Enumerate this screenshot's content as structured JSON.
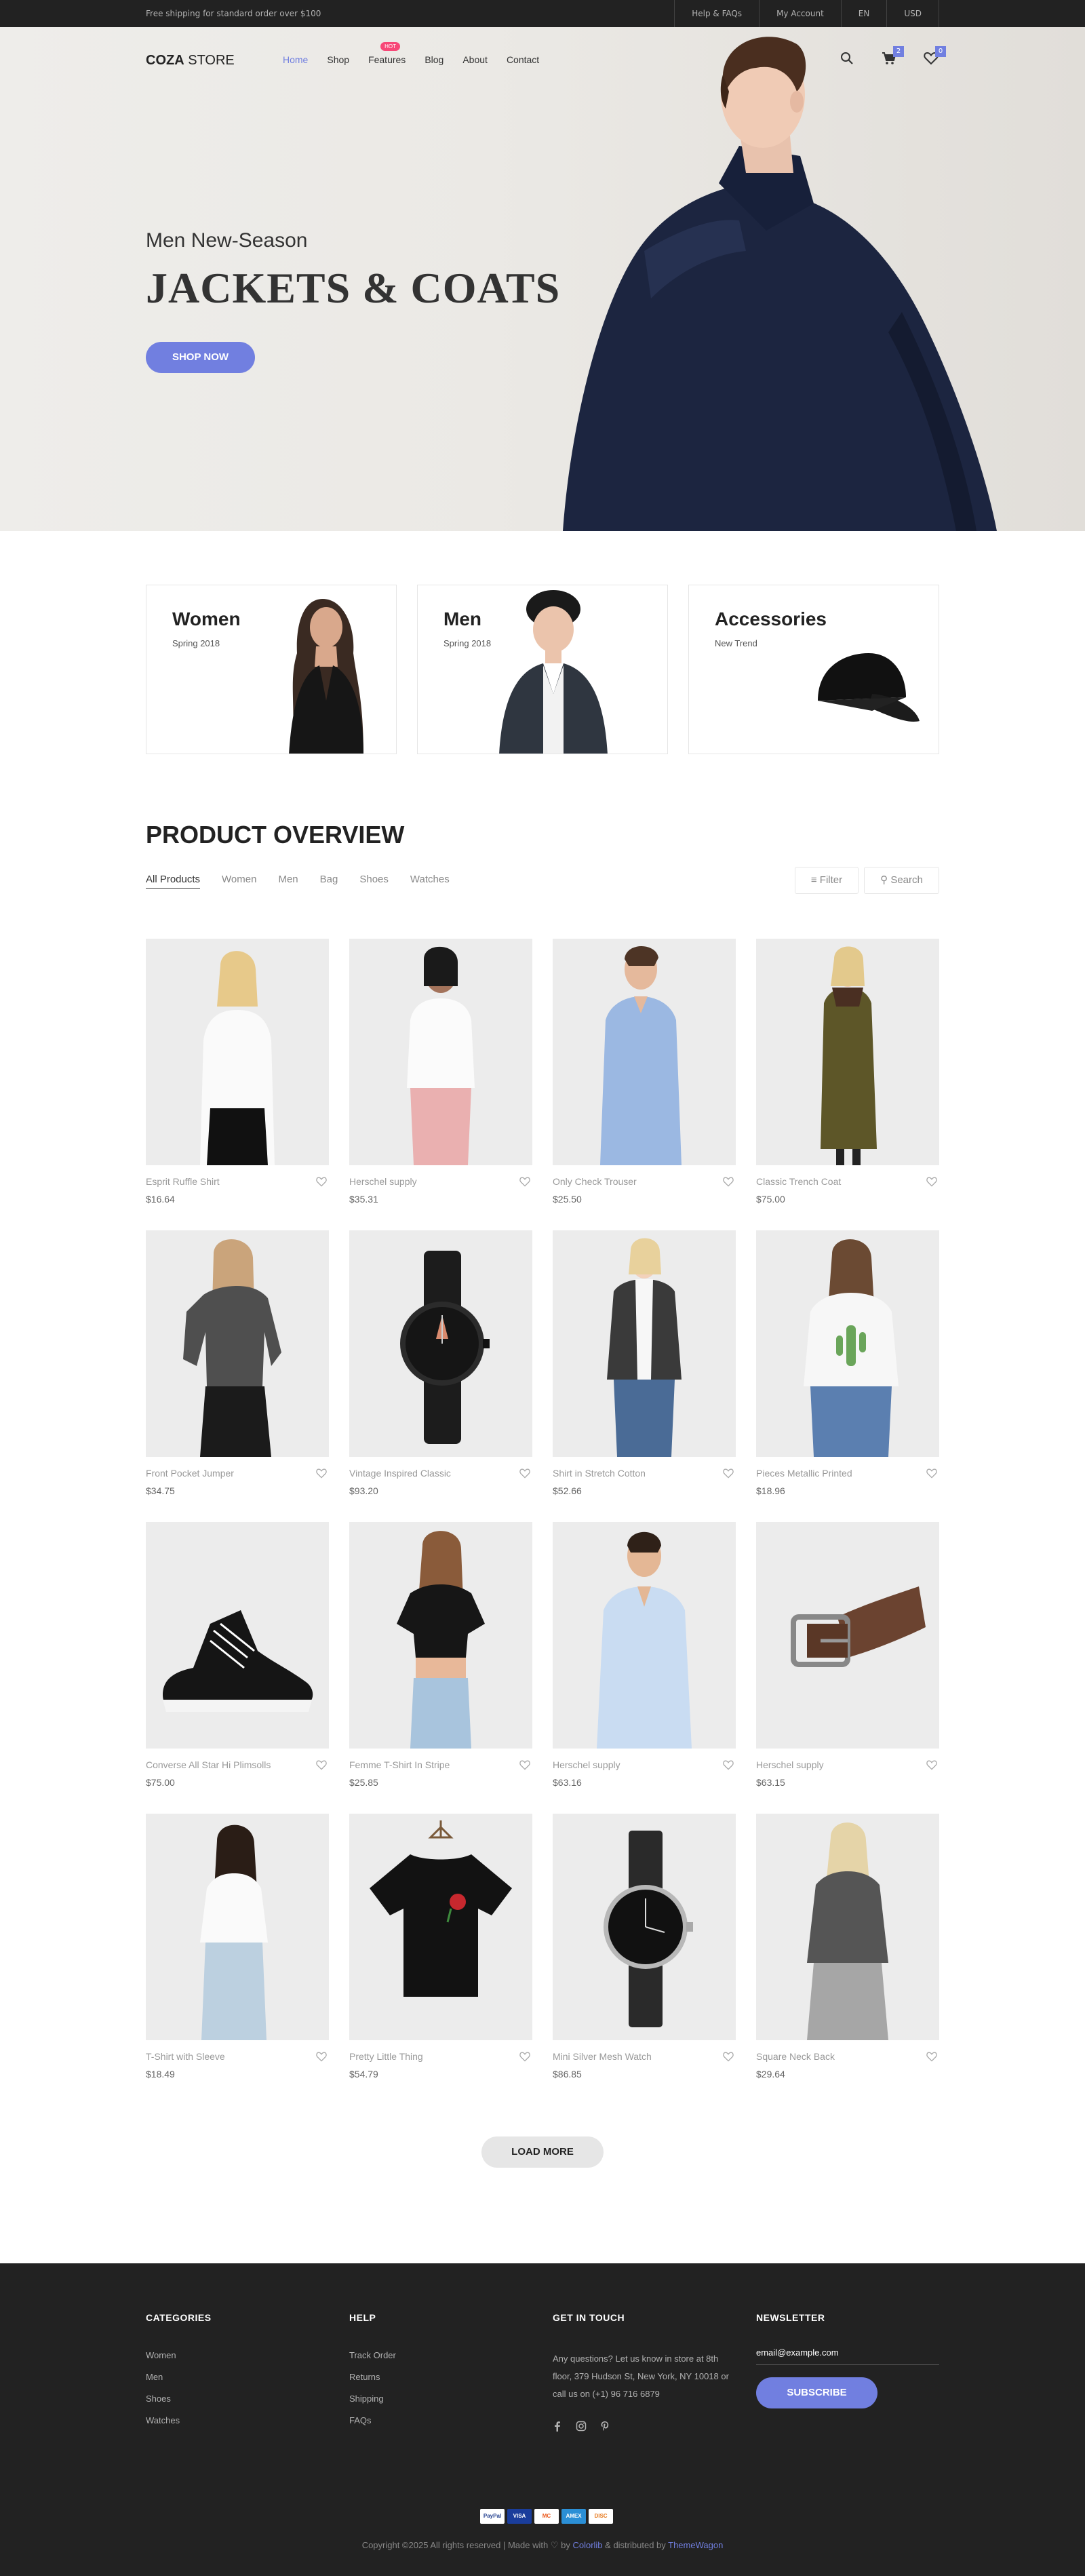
{
  "topbar": {
    "shipping_text": "Free shipping for standard order over $100",
    "links": [
      "Help & FAQs",
      "My Account",
      "EN",
      "USD"
    ]
  },
  "header": {
    "logo_bold": "COZA",
    "logo_light": " STORE",
    "menu": [
      {
        "label": "Home",
        "active": true
      },
      {
        "label": "Shop",
        "active": false
      },
      {
        "label": "Features",
        "active": false,
        "badge": "HOT"
      },
      {
        "label": "Blog",
        "active": false
      },
      {
        "label": "About",
        "active": false
      },
      {
        "label": "Contact",
        "active": false
      }
    ],
    "icons": [
      "search-icon",
      "cart-icon",
      "heart-icon"
    ],
    "cart_count": "2",
    "wishlist_count": "0"
  },
  "hero": {
    "subtitle": "Men New-Season",
    "title": "JACKETS & COATS",
    "button": "SHOP NOW"
  },
  "banners": [
    {
      "title": "Women",
      "subtitle": "Spring 2018"
    },
    {
      "title": "Men",
      "subtitle": "Spring 2018"
    },
    {
      "title": "Accessories",
      "subtitle": "New Trend"
    }
  ],
  "overview": {
    "title": "PRODUCT OVERVIEW",
    "filters": [
      "All Products",
      "Women",
      "Men",
      "Bag",
      "Shoes",
      "Watches"
    ],
    "filter_button": "Filter",
    "search_button": "Search"
  },
  "products": [
    {
      "name": "Esprit Ruffle Shirt",
      "price": "$16.64",
      "image": "woman-white-tee"
    },
    {
      "name": "Herschel supply",
      "price": "$35.31",
      "image": "woman-white-shirt-pink-pants"
    },
    {
      "name": "Only Check Trouser",
      "price": "$25.50",
      "image": "man-blue-shirt"
    },
    {
      "name": "Classic Trench Coat",
      "price": "$75.00",
      "image": "woman-olive-coat"
    },
    {
      "name": "Front Pocket Jumper",
      "price": "$34.75",
      "image": "woman-grey-blouse"
    },
    {
      "name": "Vintage Inspired Classic",
      "price": "$93.20",
      "image": "black-watch"
    },
    {
      "name": "Shirt in Stretch Cotton",
      "price": "$52.66",
      "image": "woman-blazer-jeans"
    },
    {
      "name": "Pieces Metallic Printed",
      "price": "$18.96",
      "image": "woman-cactus-tee"
    },
    {
      "name": "Converse All Star Hi Plimsolls",
      "price": "$75.00",
      "image": "black-sneaker"
    },
    {
      "name": "Femme T-Shirt In Stripe",
      "price": "$25.85",
      "image": "woman-black-crop"
    },
    {
      "name": "Herschel supply",
      "price": "$63.16",
      "image": "man-light-shirt"
    },
    {
      "name": "Herschel supply",
      "price": "$63.15",
      "image": "brown-belt"
    },
    {
      "name": "T-Shirt with Sleeve",
      "price": "$18.49",
      "image": "woman-white-tee-jeans"
    },
    {
      "name": "Pretty Little Thing",
      "price": "$54.79",
      "image": "black-tee-rose"
    },
    {
      "name": "Mini Silver Mesh Watch",
      "price": "$86.85",
      "image": "silver-watch"
    },
    {
      "name": "Square Neck Back",
      "price": "$29.64",
      "image": "woman-grey-tee"
    }
  ],
  "load_more": "LOAD MORE",
  "footer": {
    "categories": {
      "title": "CATEGORIES",
      "links": [
        "Women",
        "Men",
        "Shoes",
        "Watches"
      ]
    },
    "help": {
      "title": "HELP",
      "links": [
        "Track Order",
        "Returns",
        "Shipping",
        "FAQs"
      ]
    },
    "contact": {
      "title": "GET IN TOUCH",
      "text": "Any questions? Let us know in store at 8th floor, 379 Hudson St, New York, NY 10018 or call us on (+1) 96 716 6879",
      "social": [
        "facebook-icon",
        "instagram-icon",
        "pinterest-icon"
      ]
    },
    "newsletter": {
      "title": "NEWSLETTER",
      "placeholder": "email@example.com",
      "button": "SUBSCRIBE"
    },
    "payments": [
      "PayPal",
      "VISA",
      "MC",
      "AMEX",
      "DISC"
    ],
    "copyright_prefix": "Copyright ©2025 All rights reserved | Made with",
    "copyright_by": " by ",
    "copyright_brand1": "Colorlib",
    "copyright_dist": " & distributed by ",
    "copyright_brand2": "ThemeWagon"
  },
  "colors": {
    "accent": "#717fe0",
    "hot_badge": "#f74877",
    "footer_bg": "#222222",
    "topbar_bg": "#222222"
  }
}
